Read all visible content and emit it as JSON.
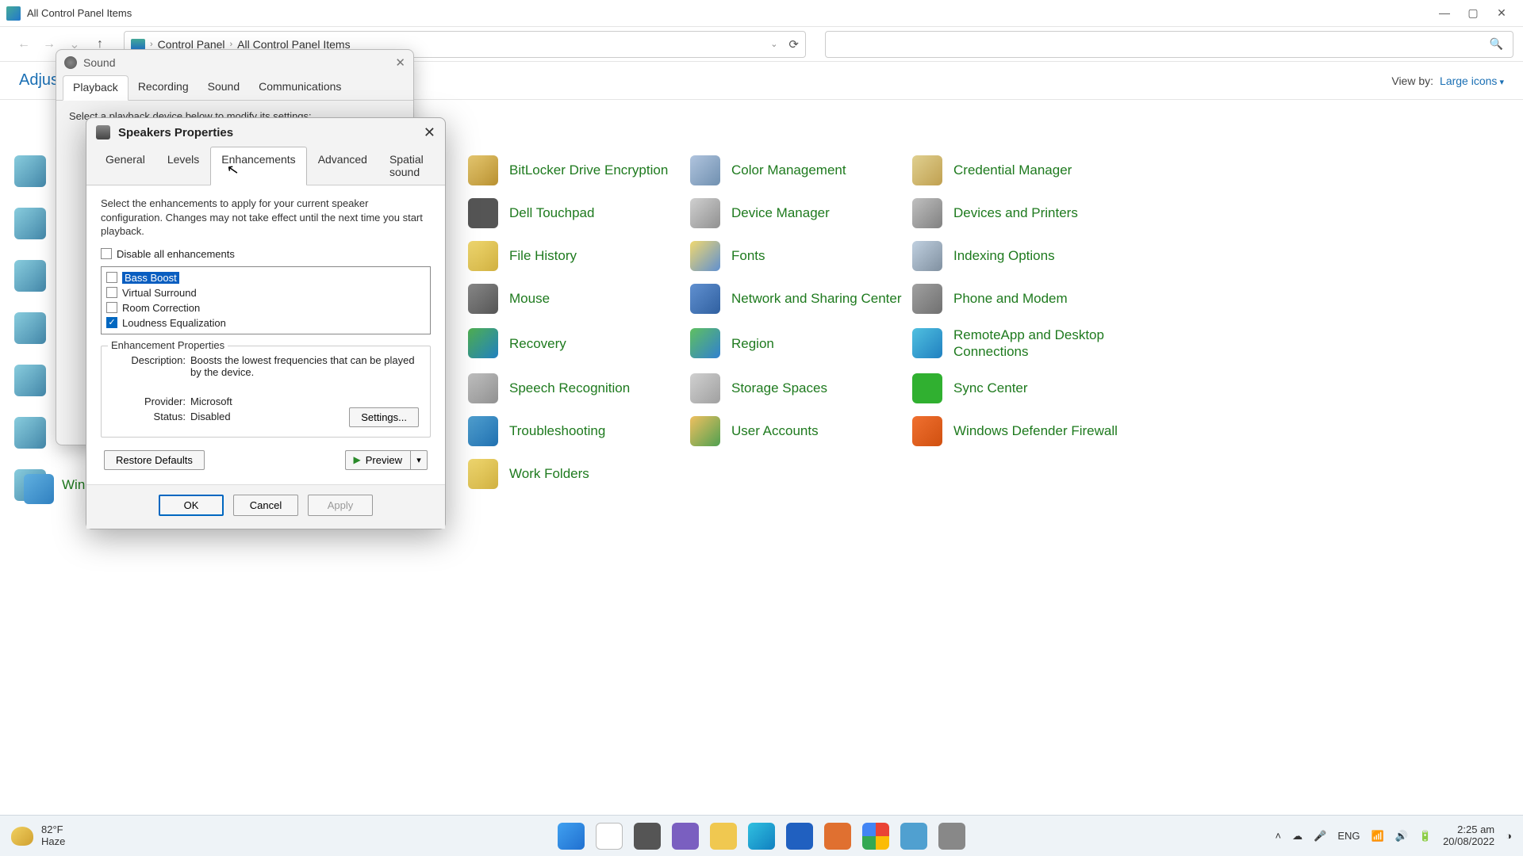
{
  "window": {
    "title": "All Control Panel Items",
    "breadcrumb": [
      "Control Panel",
      "All Control Panel Items"
    ]
  },
  "content_header": {
    "adjust_label": "Adjust",
    "view_by_label": "View by:",
    "view_by_value": "Large icons"
  },
  "cp_items": [
    "BitLocker Drive Encryption",
    "Color Management",
    "Credential Manager",
    "Dell Touchpad",
    "Device Manager",
    "Devices and Printers",
    "File History",
    "Fonts",
    "Indexing Options",
    "Mouse",
    "Network and Sharing Center",
    "Phone and Modem",
    "Recovery",
    "Region",
    "RemoteApp and Desktop Connections",
    "Speech Recognition",
    "Storage Spaces",
    "Sync Center",
    "Troubleshooting",
    "User Accounts",
    "Windows Defender Firewall",
    "Work Folders"
  ],
  "partial_item_label": "Win",
  "sound_dialog": {
    "title": "Sound",
    "tabs": [
      "Playback",
      "Recording",
      "Sound",
      "Communications"
    ],
    "active_tab": 0,
    "body_intro": "Select a playback device below to modify its settings:"
  },
  "props_dialog": {
    "title": "Speakers Properties",
    "tabs": [
      "General",
      "Levels",
      "Enhancements",
      "Advanced",
      "Spatial sound"
    ],
    "active_tab": 2,
    "intro": "Select the enhancements to apply for your current speaker configuration. Changes may not take effect until the next time you start playback.",
    "disable_all_label": "Disable all enhancements",
    "disable_all_checked": false,
    "enhancements": [
      {
        "label": "Bass Boost",
        "checked": false,
        "selected": true
      },
      {
        "label": "Virtual Surround",
        "checked": false,
        "selected": false
      },
      {
        "label": "Room Correction",
        "checked": false,
        "selected": false
      },
      {
        "label": "Loudness Equalization",
        "checked": true,
        "selected": false
      }
    ],
    "group_title": "Enhancement Properties",
    "description_label": "Description:",
    "description_value": "Boosts the lowest frequencies that can be played by the device.",
    "provider_label": "Provider:",
    "provider_value": "Microsoft",
    "status_label": "Status:",
    "status_value": "Disabled",
    "settings_button": "Settings...",
    "restore_button": "Restore Defaults",
    "preview_button": "Preview",
    "ok_button": "OK",
    "cancel_button": "Cancel",
    "apply_button": "Apply"
  },
  "taskbar": {
    "weather_temp": "82°F",
    "weather_desc": "Haze",
    "lang": "ENG",
    "time": "2:25 am",
    "date": "20/08/2022"
  }
}
